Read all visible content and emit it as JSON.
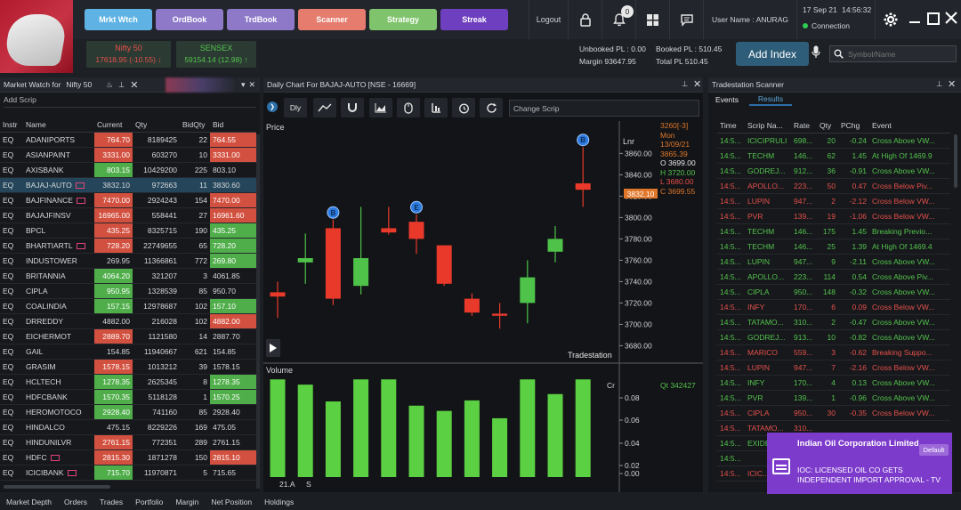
{
  "nav": {
    "buttons": [
      {
        "label": "Mrkt Wtch",
        "color": "#5eb3e4"
      },
      {
        "label": "OrdBook",
        "color": "#8e79c9"
      },
      {
        "label": "TrdBook",
        "color": "#8e79c9"
      },
      {
        "label": "Scanner",
        "color": "#e57c6e"
      },
      {
        "label": "Strategy",
        "color": "#7fc46c"
      },
      {
        "label": "Streak",
        "color": "#6e3fbf"
      }
    ],
    "logout": "Logout",
    "notification_count": "0",
    "user": "User Name : ANURAG",
    "date": "17 Sep 21",
    "time": "14:56:32",
    "connection": "Connection"
  },
  "indices": [
    {
      "name": "Nifty 50",
      "value": "17618.95 (-10.55)",
      "color": "#e5504a"
    },
    {
      "name": "SENSEX",
      "value": "59154.14 (12.98)",
      "color": "#54c24c"
    }
  ],
  "pnl": {
    "unbooked": "Unbooked PL : 0.00",
    "booked": "Booked PL : 510.45",
    "margin": "Margin  93647.95",
    "total": "Total PL  510.45"
  },
  "add_index": "Add Index",
  "symbol_search": {
    "placeholder": "Symbol/Name"
  },
  "market_watch": {
    "title": "Market Watch for",
    "group": "Nifty 50",
    "add_scrip": "Add Scrip",
    "columns": [
      "Instr",
      "Name",
      "Current",
      "Qty",
      "BidQty",
      "Bid"
    ],
    "rows": [
      {
        "instr": "EQ",
        "name": "ADANIPORTS",
        "current": "764.70",
        "cur_c": "r",
        "qty": "8189425",
        "bidqty": "22",
        "bid": "764.55",
        "bid_c": "r",
        "badge": false
      },
      {
        "instr": "EQ",
        "name": "ASIANPAINT",
        "current": "3331.00",
        "cur_c": "r",
        "qty": "603270",
        "bidqty": "10",
        "bid": "3331.00",
        "bid_c": "r",
        "badge": false
      },
      {
        "instr": "EQ",
        "name": "AXISBANK",
        "current": "803.15",
        "cur_c": "g",
        "qty": "10429200",
        "bidqty": "225",
        "bid": "803.10",
        "bid_c": "n",
        "badge": false
      },
      {
        "instr": "EQ",
        "name": "BAJAJ-AUTO",
        "current": "3832.10",
        "cur_c": "n",
        "qty": "972663",
        "bidqty": "11",
        "bid": "3830.60",
        "bid_c": "n",
        "badge": true,
        "selected": true
      },
      {
        "instr": "EQ",
        "name": "BAJFINANCE",
        "current": "7470.00",
        "cur_c": "r",
        "qty": "2924243",
        "bidqty": "154",
        "bid": "7470.00",
        "bid_c": "r",
        "badge": true
      },
      {
        "instr": "EQ",
        "name": "BAJAJFINSV",
        "current": "16965.00",
        "cur_c": "r",
        "qty": "558441",
        "bidqty": "27",
        "bid": "16961.60",
        "bid_c": "r",
        "badge": false
      },
      {
        "instr": "EQ",
        "name": "BPCL",
        "current": "435.25",
        "cur_c": "r",
        "qty": "8325715",
        "bidqty": "190",
        "bid": "435.25",
        "bid_c": "g",
        "badge": false
      },
      {
        "instr": "EQ",
        "name": "BHARTIARTL",
        "current": "728.20",
        "cur_c": "r",
        "qty": "22749655",
        "bidqty": "65",
        "bid": "728.20",
        "bid_c": "g",
        "badge": true
      },
      {
        "instr": "EQ",
        "name": "INDUSTOWER",
        "current": "269.95",
        "cur_c": "n",
        "qty": "11366861",
        "bidqty": "772",
        "bid": "269.80",
        "bid_c": "g",
        "badge": false
      },
      {
        "instr": "EQ",
        "name": "BRITANNIA",
        "current": "4064.20",
        "cur_c": "g",
        "qty": "321207",
        "bidqty": "3",
        "bid": "4061.85",
        "bid_c": "n",
        "badge": false
      },
      {
        "instr": "EQ",
        "name": "CIPLA",
        "current": "950.95",
        "cur_c": "g",
        "qty": "1328539",
        "bidqty": "85",
        "bid": "950.70",
        "bid_c": "n",
        "badge": false
      },
      {
        "instr": "EQ",
        "name": "COALINDIA",
        "current": "157.15",
        "cur_c": "g",
        "qty": "12978687",
        "bidqty": "102",
        "bid": "157.10",
        "bid_c": "g",
        "badge": false
      },
      {
        "instr": "EQ",
        "name": "DRREDDY",
        "current": "4882.00",
        "cur_c": "n",
        "qty": "216028",
        "bidqty": "102",
        "bid": "4882.00",
        "bid_c": "r",
        "badge": false
      },
      {
        "instr": "EQ",
        "name": "EICHERMOT",
        "current": "2889.70",
        "cur_c": "r",
        "qty": "1121580",
        "bidqty": "14",
        "bid": "2887.70",
        "bid_c": "n",
        "badge": false
      },
      {
        "instr": "EQ",
        "name": "GAIL",
        "current": "154.85",
        "cur_c": "n",
        "qty": "11940667",
        "bidqty": "621",
        "bid": "154.85",
        "bid_c": "n",
        "badge": false
      },
      {
        "instr": "EQ",
        "name": "GRASIM",
        "current": "1578.15",
        "cur_c": "r",
        "qty": "1013212",
        "bidqty": "39",
        "bid": "1578.15",
        "bid_c": "n",
        "badge": false
      },
      {
        "instr": "EQ",
        "name": "HCLTECH",
        "current": "1278.35",
        "cur_c": "g",
        "qty": "2625345",
        "bidqty": "8",
        "bid": "1278.35",
        "bid_c": "g",
        "badge": false
      },
      {
        "instr": "EQ",
        "name": "HDFCBANK",
        "current": "1570.35",
        "cur_c": "g",
        "qty": "5118128",
        "bidqty": "1",
        "bid": "1570.25",
        "bid_c": "g",
        "badge": false
      },
      {
        "instr": "EQ",
        "name": "HEROMOTOCO",
        "current": "2928.40",
        "cur_c": "g",
        "qty": "741160",
        "bidqty": "85",
        "bid": "2928.40",
        "bid_c": "n",
        "badge": false
      },
      {
        "instr": "EQ",
        "name": "HINDALCO",
        "current": "475.15",
        "cur_c": "n",
        "qty": "8229226",
        "bidqty": "169",
        "bid": "475.05",
        "bid_c": "n",
        "badge": false
      },
      {
        "instr": "EQ",
        "name": "HINDUNILVR",
        "current": "2761.15",
        "cur_c": "r",
        "qty": "772351",
        "bidqty": "289",
        "bid": "2761.15",
        "bid_c": "n",
        "badge": false
      },
      {
        "instr": "EQ",
        "name": "HDFC",
        "current": "2815.30",
        "cur_c": "r",
        "qty": "1871278",
        "bidqty": "150",
        "bid": "2815.10",
        "bid_c": "r",
        "badge": true
      },
      {
        "instr": "EQ",
        "name": "ICICIBANK",
        "current": "715.70",
        "cur_c": "g",
        "qty": "11970871",
        "bidqty": "5",
        "bid": "715.65",
        "bid_c": "n",
        "badge": true
      }
    ]
  },
  "chart": {
    "title": "Daily Chart For BAJAJ-AUTO [NSE - 16669]",
    "interval_label": "Dly",
    "change_scrip_placeholder": "Change Scrip",
    "price_label": "Price",
    "scale_label": "Lnr",
    "volume_label": "Volume",
    "volume_scale_label": "Cr",
    "watermark": "Tradestation",
    "qty_label": "Qt 342427",
    "ohlc": {
      "header": "3260[-3]",
      "day": "Mon",
      "date": "13/09/21",
      "last": "3865.39",
      "open": "O  3699.00",
      "high": "H  3720.00",
      "low": "L  3680.00",
      "close": "C  3699.55"
    },
    "current_price_tag": "3832.10",
    "x_labels": [
      "21.A",
      "S"
    ]
  },
  "chart_data": {
    "type": "candlestick",
    "y_ticks": [
      3860,
      3840,
      3820,
      3800,
      3780,
      3760,
      3740,
      3720,
      3700,
      3680
    ],
    "ylim": [
      3672,
      3882
    ],
    "candles": [
      {
        "o": 3730,
        "h": 3740,
        "l": 3706,
        "c": 3726
      },
      {
        "o": 3758,
        "h": 3785,
        "l": 3738,
        "c": 3762
      },
      {
        "o": 3790,
        "h": 3798,
        "l": 3718,
        "c": 3724,
        "marker": "B"
      },
      {
        "o": 3736,
        "h": 3810,
        "l": 3728,
        "c": 3762
      },
      {
        "o": 3790,
        "h": 3810,
        "l": 3784,
        "c": 3786
      },
      {
        "o": 3796,
        "h": 3803,
        "l": 3766,
        "c": 3780,
        "marker": "E"
      },
      {
        "o": 3774,
        "h": 3774,
        "l": 3736,
        "c": 3738
      },
      {
        "o": 3724,
        "h": 3729,
        "l": 3708,
        "c": 3711
      },
      {
        "o": 3710,
        "h": 3720,
        "l": 3696,
        "c": 3708
      },
      {
        "o": 3720,
        "h": 3760,
        "l": 3701,
        "c": 3744
      },
      {
        "o": 3768,
        "h": 3792,
        "l": 3758,
        "c": 3780
      },
      {
        "o": 3832,
        "h": 3866,
        "l": 3810,
        "c": 3826,
        "marker": "B"
      }
    ],
    "volume_ticks": [
      "0.08",
      "0.06",
      "0.04",
      "0.02",
      "0.00",
      "0.08",
      "0.06",
      "0.04",
      "0.02",
      "0.00"
    ],
    "volume": [
      0.93,
      0.88,
      0.72,
      0.93,
      0.93,
      0.68,
      0.63,
      0.73,
      0.56,
      0.93,
      0.79,
      0.93
    ]
  },
  "scanner": {
    "title": "Tradestation Scanner",
    "tabs": [
      "Events",
      "Results"
    ],
    "columns": [
      "Time",
      "Scrip Na...",
      "Rate",
      "Qty",
      "PChg",
      "Event"
    ],
    "rows": [
      {
        "time": "14:5...",
        "scrip": "ICICIPRULI",
        "rate": "698...",
        "qty": "20",
        "pchg": "-0.24",
        "event": "Cross Above VW...",
        "c": "g"
      },
      {
        "time": "14:5...",
        "scrip": "TECHM",
        "rate": "146...",
        "qty": "62",
        "pchg": "1.45",
        "event": "At High Of 1469.9",
        "c": "g"
      },
      {
        "time": "14:5...",
        "scrip": "GODREJ...",
        "rate": "912...",
        "qty": "36",
        "pchg": "-0.91",
        "event": "Cross Above VW...",
        "c": "g"
      },
      {
        "time": "14:5...",
        "scrip": "APOLLO...",
        "rate": "223...",
        "qty": "50",
        "pchg": "0.47",
        "event": "Cross Below Piv...",
        "c": "r"
      },
      {
        "time": "14:5...",
        "scrip": "LUPIN",
        "rate": "947...",
        "qty": "2",
        "pchg": "-2.12",
        "event": "Cross Below VW...",
        "c": "r"
      },
      {
        "time": "14:5...",
        "scrip": "PVR",
        "rate": "139...",
        "qty": "19",
        "pchg": "-1.06",
        "event": "Cross Below VW...",
        "c": "r"
      },
      {
        "time": "14:5...",
        "scrip": "TECHM",
        "rate": "146...",
        "qty": "175",
        "pchg": "1.45",
        "event": "Breaking Previo...",
        "c": "g"
      },
      {
        "time": "14:5...",
        "scrip": "TECHM",
        "rate": "146...",
        "qty": "25",
        "pchg": "1.39",
        "event": "At High Of 1469.4",
        "c": "g"
      },
      {
        "time": "14:5...",
        "scrip": "LUPIN",
        "rate": "947...",
        "qty": "9",
        "pchg": "-2.11",
        "event": "Cross Above VW...",
        "c": "g"
      },
      {
        "time": "14:5...",
        "scrip": "APOLLO...",
        "rate": "223...",
        "qty": "114",
        "pchg": "0.54",
        "event": "Cross Above Piv...",
        "c": "g"
      },
      {
        "time": "14:5...",
        "scrip": "CIPLA",
        "rate": "950...",
        "qty": "148",
        "pchg": "-0.32",
        "event": "Cross Above VW...",
        "c": "g"
      },
      {
        "time": "14:5...",
        "scrip": "INFY",
        "rate": "170...",
        "qty": "6",
        "pchg": "0.09",
        "event": "Cross Below VW...",
        "c": "r"
      },
      {
        "time": "14:5...",
        "scrip": "TATAMO...",
        "rate": "310...",
        "qty": "2",
        "pchg": "-0.47",
        "event": "Cross Above VW...",
        "c": "g"
      },
      {
        "time": "14:5...",
        "scrip": "GODREJ...",
        "rate": "913...",
        "qty": "10",
        "pchg": "-0.82",
        "event": "Cross Above VW...",
        "c": "g"
      },
      {
        "time": "14:5...",
        "scrip": "MARICO",
        "rate": "559...",
        "qty": "3",
        "pchg": "-0.62",
        "event": "Breaking Suppo...",
        "c": "r"
      },
      {
        "time": "14:5...",
        "scrip": "LUPIN",
        "rate": "947...",
        "qty": "7",
        "pchg": "-2.16",
        "event": "Cross Below VW...",
        "c": "r"
      },
      {
        "time": "14:5...",
        "scrip": "INFY",
        "rate": "170...",
        "qty": "4",
        "pchg": "0.13",
        "event": "Cross Above VW...",
        "c": "g"
      },
      {
        "time": "14:5...",
        "scrip": "PVR",
        "rate": "139...",
        "qty": "1",
        "pchg": "-0.96",
        "event": "Cross Above VW...",
        "c": "g"
      },
      {
        "time": "14:5...",
        "scrip": "CIPLA",
        "rate": "950...",
        "qty": "30",
        "pchg": "-0.35",
        "event": "Cross Below VW...",
        "c": "r"
      },
      {
        "time": "14:5...",
        "scrip": "TATAMO...",
        "rate": "310...",
        "qty": "",
        "pchg": "",
        "event": "",
        "c": "r"
      },
      {
        "time": "14:5...",
        "scrip": "EXIDE...",
        "rate": "",
        "qty": "",
        "pchg": "",
        "event": "",
        "c": "g"
      },
      {
        "time": "14:5...",
        "scrip": "",
        "rate": "",
        "qty": "",
        "pchg": "",
        "event": "",
        "c": "g"
      },
      {
        "time": "14:5...",
        "scrip": "ICIC...",
        "rate": "",
        "qty": "",
        "pchg": "",
        "event": "",
        "c": "r"
      }
    ]
  },
  "toast": {
    "title": "Indian Oil Corporation Limited",
    "tag": "Default",
    "message": "IOC: LICENSED OIL CO GETS INDEPENDENT IMPORT APPROVAL - TV"
  },
  "bottom_tabs": [
    "Market Depth",
    "Orders",
    "Trades",
    "Portfolio",
    "Margin",
    "Net Position",
    "Holdings"
  ]
}
